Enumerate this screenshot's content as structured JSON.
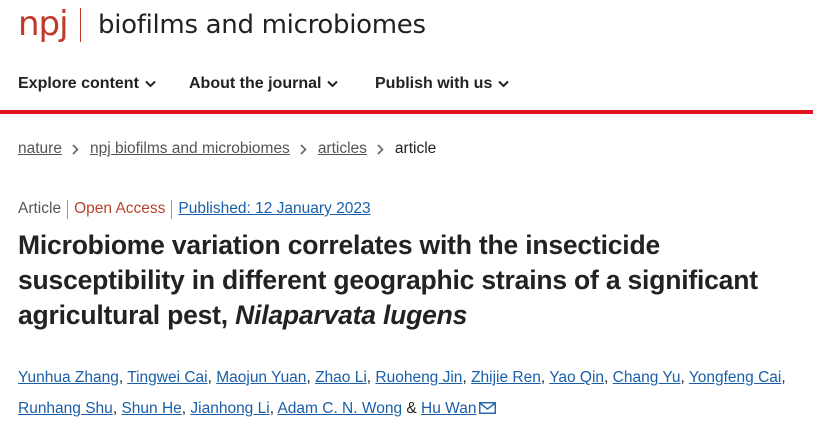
{
  "header": {
    "logo": "npj",
    "journal_title": "biofilms and microbiomes"
  },
  "nav": {
    "items": [
      {
        "label": "Explore content",
        "icon": "chevron-down-icon"
      },
      {
        "label": "About the journal",
        "icon": "chevron-down-icon"
      },
      {
        "label": "Publish with us",
        "icon": "chevron-down-icon"
      }
    ]
  },
  "breadcrumb": {
    "items": [
      "nature",
      "npj biofilms and microbiomes",
      "articles"
    ],
    "current": "article"
  },
  "meta": {
    "type": "Article",
    "access": "Open Access",
    "published": "Published: 12 January 2023"
  },
  "article": {
    "title_main": "Microbiome variation correlates with the insecticide susceptibility in different geographic strains of a significant agricultural pest,",
    "title_species": "Nilaparvata lugens"
  },
  "authors": {
    "list": [
      "Yunhua Zhang",
      "Tingwei Cai",
      "Maojun Yuan",
      "Zhao Li",
      "Ruoheng Jin",
      "Zhijie Ren",
      "Yao Qin",
      "Chang Yu",
      "Yongfeng Cai",
      "Runhang Shu",
      "Shun He",
      "Jianhong Li",
      "Adam C. N. Wong",
      "Hu Wan"
    ],
    "separator": ",",
    "last_joiner": "&",
    "contact_icon": "mail-icon"
  },
  "colors": {
    "brand_red": "#e0141e",
    "link_blue": "#1a5fa8",
    "open_access": "#b5452e"
  }
}
